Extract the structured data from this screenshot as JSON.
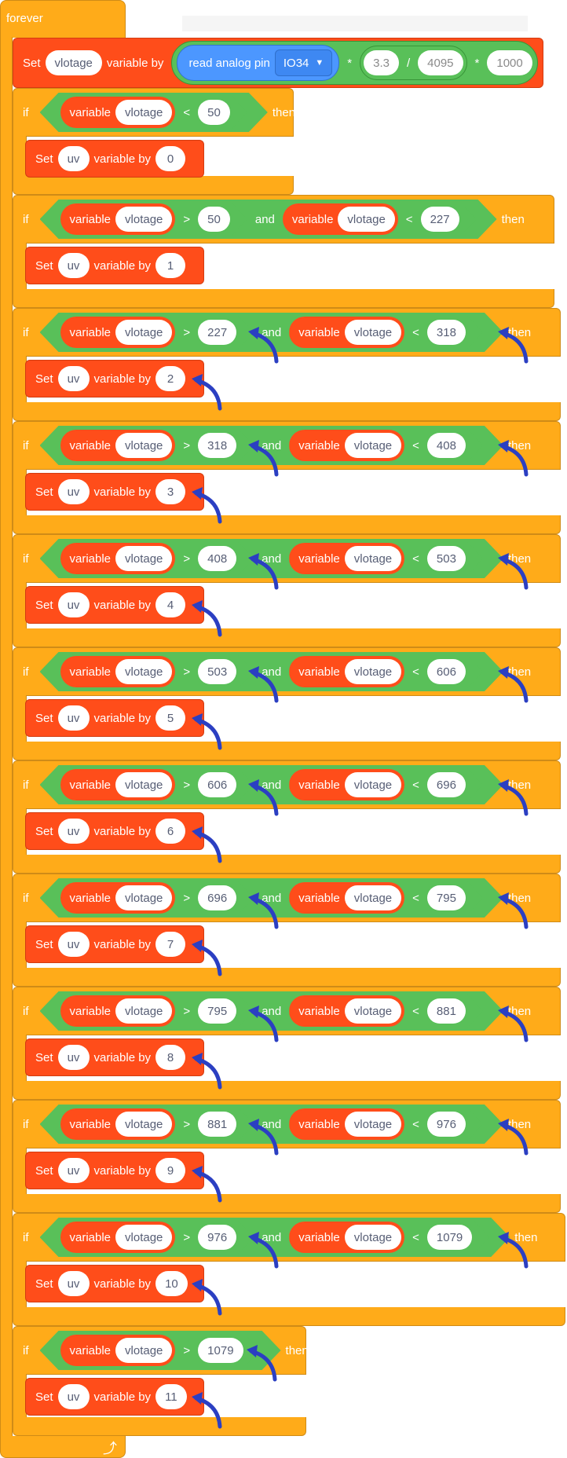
{
  "forever": {
    "label": "forever"
  },
  "set_vlotage": {
    "set_label": "Set",
    "variable": "vlotage",
    "by_label": "variable by",
    "read_label": "read analog pin",
    "pin": "IO34",
    "mul1": "*",
    "v1": "3.3",
    "div": "/",
    "v2": "4095",
    "mul2": "*",
    "v3": "1000"
  },
  "labels": {
    "if": "if",
    "then": "then",
    "and": "and",
    "variable": "variable",
    "var_name": "vlotage",
    "set": "Set",
    "uv": "uv",
    "variable_by": "variable by",
    "lt": "<",
    "gt": ">"
  },
  "blocks": [
    {
      "kind": "single",
      "op": "<",
      "value": "50",
      "result": "0"
    },
    {
      "kind": "range",
      "low": "50",
      "high": "227",
      "result": "1"
    },
    {
      "kind": "range",
      "low": "227",
      "high": "318",
      "result": "2"
    },
    {
      "kind": "range",
      "low": "318",
      "high": "408",
      "result": "3"
    },
    {
      "kind": "range",
      "low": "408",
      "high": "503",
      "result": "4"
    },
    {
      "kind": "range",
      "low": "503",
      "high": "606",
      "result": "5"
    },
    {
      "kind": "range",
      "low": "606",
      "high": "696",
      "result": "6"
    },
    {
      "kind": "range",
      "low": "696",
      "high": "795",
      "result": "7"
    },
    {
      "kind": "range",
      "low": "795",
      "high": "881",
      "result": "8"
    },
    {
      "kind": "range",
      "low": "881",
      "high": "976",
      "result": "9"
    },
    {
      "kind": "range",
      "low": "976",
      "high": "1079",
      "result": "10"
    },
    {
      "kind": "single",
      "op": ">",
      "value": "1079",
      "result": "11"
    }
  ],
  "colors": {
    "control": "#FFAB19",
    "variables": "#FF4D1A",
    "operators": "#59C059",
    "pins": "#4C97FF",
    "annotation_arrow": "#2B3FC2"
  },
  "icons": {
    "loop": "loop-arrow-icon",
    "dropdown": "dropdown-triangle-icon",
    "annotation": "curved-arrow-icon"
  }
}
